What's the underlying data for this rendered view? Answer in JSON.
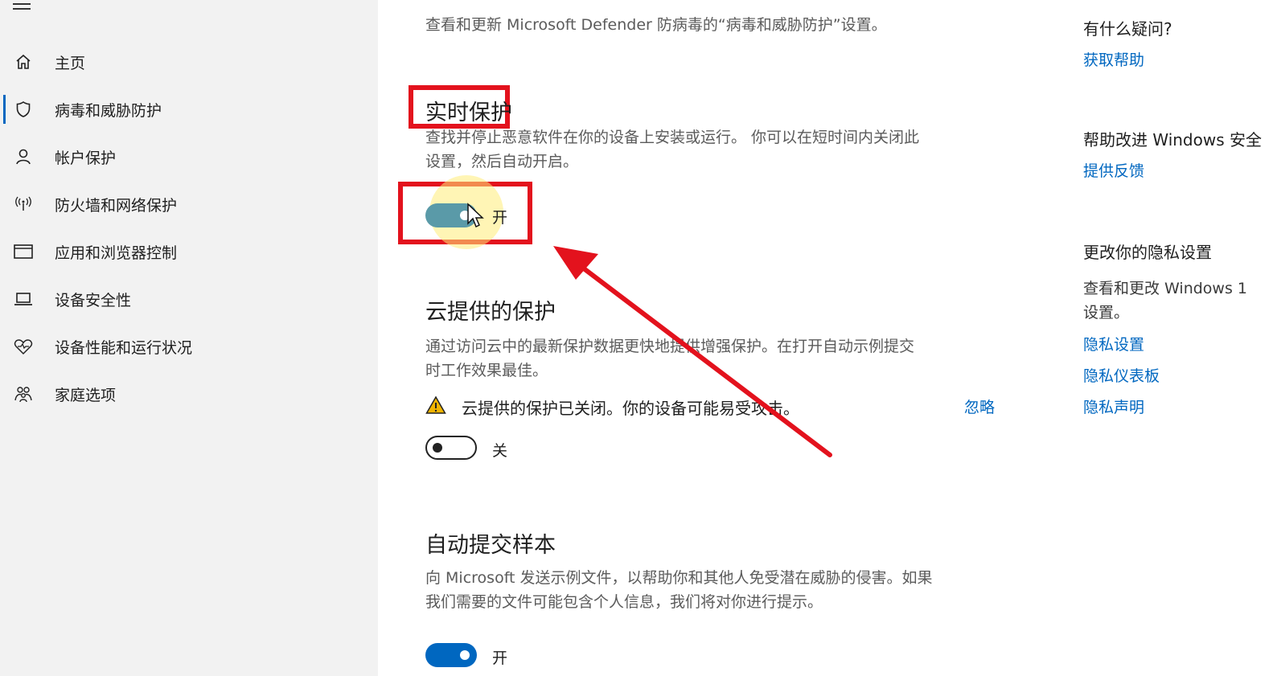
{
  "sidebar": {
    "items": [
      {
        "label": "主页",
        "icon": "home-icon"
      },
      {
        "label": "病毒和威胁防护",
        "icon": "shield-icon"
      },
      {
        "label": "帐户保护",
        "icon": "person-icon"
      },
      {
        "label": "防火墙和网络保护",
        "icon": "wireless-icon"
      },
      {
        "label": "应用和浏览器控制",
        "icon": "browser-window-icon"
      },
      {
        "label": "设备安全性",
        "icon": "laptop-icon"
      },
      {
        "label": "设备性能和运行状况",
        "icon": "heart-pulse-icon"
      },
      {
        "label": "家庭选项",
        "icon": "family-icon"
      }
    ]
  },
  "main": {
    "intro": "查看和更新 Microsoft Defender 防病毒的“病毒和威胁防护”设置。",
    "realtime": {
      "title": "实时保护",
      "desc1": "查找并停止恶意软件在你的设备上安装或运行。 你可以在短时间内关闭此",
      "desc2": "设置，然后自动开启。",
      "state": "开"
    },
    "cloud": {
      "title": "云提供的保护",
      "desc1": "通过访问云中的最新保护数据更快地提供增强保护。在打开自动示例提交",
      "desc2": "时工作效果最佳。",
      "warning": "云提供的保护已关闭。你的设备可能易受攻击。",
      "dismiss": "忽略",
      "state": "关"
    },
    "sample": {
      "title": "自动提交样本",
      "desc1": "向 Microsoft 发送示例文件，以帮助你和其他人免受潜在威胁的侵害。如果",
      "desc2": "我们需要的文件可能包含个人信息，我们将对你进行提示。",
      "state": "开"
    }
  },
  "right": {
    "question_title": "有什么疑问?",
    "get_help": "获取帮助",
    "improve_title": "帮助改进 Windows 安全",
    "feedback": "提供反馈",
    "privacy_title": "更改你的隐私设置",
    "privacy_desc1": "查看和更改 Windows 1",
    "privacy_desc2": "设置。",
    "privacy_settings": "隐私设置",
    "privacy_dashboard": "隐私仪表板",
    "privacy_statement": "隐私声明"
  },
  "colors": {
    "accent": "#0067c0",
    "annotation": "#e3121d",
    "warning": "#f0b400"
  }
}
